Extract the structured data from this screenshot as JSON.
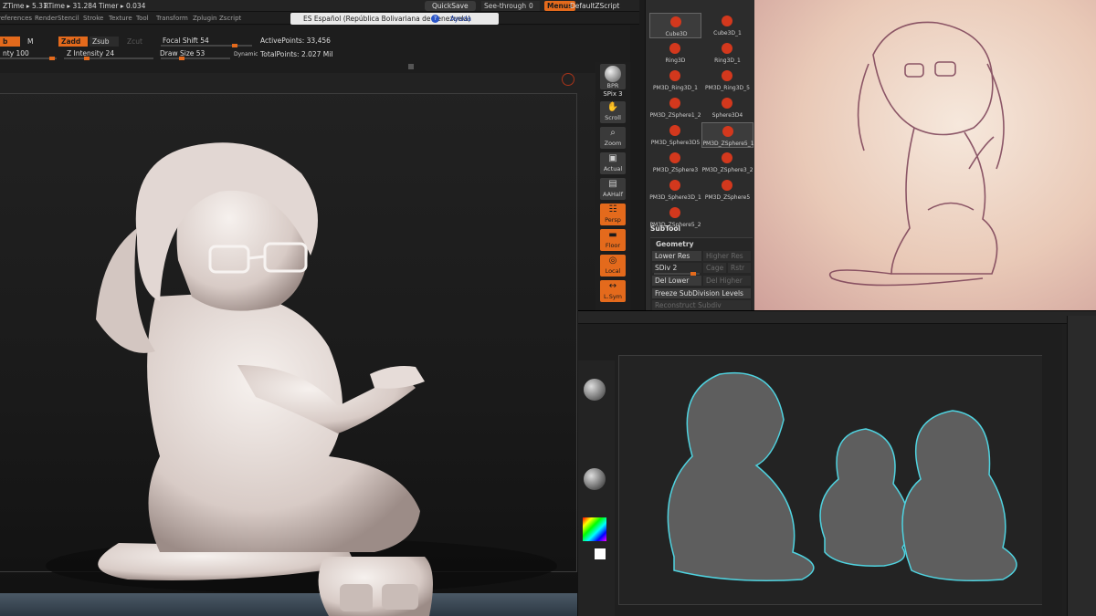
{
  "status": {
    "ztime": "ZTime ▸ 5.31",
    "rtime": "RTime ▸ 31.284",
    "timer": "Timer ▸ 0.034",
    "quicksave": "QuickSave",
    "seethrough": "See-through",
    "seethrough_value": "0",
    "menus": "Menus",
    "script": "DefaultZScript"
  },
  "menubar": {
    "items": [
      "references",
      "Render",
      "Stencil",
      "Stroke",
      "Texture",
      "Tool",
      "Transform",
      "Zplugin",
      "Zscript"
    ]
  },
  "language": {
    "label": "ES Español (República Bolivariana de Venezuela)",
    "help": "Ayuda"
  },
  "brush": {
    "rgb_label": "b",
    "m_label": "M",
    "zadd": "Zadd",
    "zsub": "Zsub",
    "zcut": "Zcut",
    "focal_shift": "Focal Shift 54",
    "draw_size": "Draw Size 53",
    "dynamic": "Dynamic",
    "intensity_left": "nty 100",
    "z_intensity": "Z Intensity 24",
    "active_points": "ActivePoints: 33,456",
    "total_points": "TotalPoints: 2.027 Mil"
  },
  "shelf": {
    "bpr": "BPR",
    "spix": "SPix 3",
    "buttons": [
      {
        "label": "Scroll",
        "icon": "hand-icon",
        "glyph": "✋",
        "active": false
      },
      {
        "label": "Zoom",
        "icon": "zoom-icon",
        "glyph": "⌕",
        "active": false
      },
      {
        "label": "Actual",
        "icon": "actual-icon",
        "glyph": "▣",
        "active": false
      },
      {
        "label": "AAHalf",
        "icon": "aahalf-icon",
        "glyph": "▤",
        "active": false
      },
      {
        "label": "Persp",
        "icon": "perspective-icon",
        "glyph": "☷",
        "active": true
      },
      {
        "label": "Floor",
        "icon": "floor-icon",
        "glyph": "▬",
        "active": true
      },
      {
        "label": "Local",
        "icon": "local-icon",
        "glyph": "◎",
        "active": true
      },
      {
        "label": "L.Sym",
        "icon": "symmetry-icon",
        "glyph": "↔",
        "active": true
      }
    ]
  },
  "tools": {
    "items": [
      {
        "label": "Cube3D",
        "selected": true
      },
      {
        "label": "Cube3D_1",
        "selected": false
      },
      {
        "label": "Ring3D",
        "selected": false
      },
      {
        "label": "Ring3D_1",
        "selected": false
      },
      {
        "label": "PM3D_Ring3D_1",
        "selected": false
      },
      {
        "label": "PM3D_Ring3D_5",
        "selected": false
      },
      {
        "label": "PM3D_ZSphere1_2",
        "selected": false
      },
      {
        "label": "Sphere3D4",
        "selected": false
      },
      {
        "label": "PM3D_Sphere3D5",
        "selected": false
      },
      {
        "label": "PM3D_ZSphere5_1",
        "selected": true
      },
      {
        "label": "PM3D_ZSphere3",
        "selected": false
      },
      {
        "label": "PM3D_ZSphere3_2",
        "selected": false
      },
      {
        "label": "PM3D_Sphere3D_1",
        "selected": false
      },
      {
        "label": "PM3D_ZSphere5",
        "selected": false
      },
      {
        "label": "PM3D_ZSphere5_2",
        "selected": false
      }
    ],
    "subtool": "SubTool",
    "geometry": "Geometry",
    "lower_res": "Lower Res",
    "higher_res": "Higher Res",
    "sdiv": "SDiv 2",
    "cage": "Cage",
    "rstr": "Rstr",
    "del_lower": "Del Lower",
    "del_higher": "Del Higher",
    "freeze": "Freeze SubDivision Levels",
    "reconstruct": "Reconstruct Subdiv"
  },
  "colors": {
    "accent": "#e46a1c",
    "panel": "#2c2c2c",
    "background": "#1b1b1b",
    "model": "#e9e2df",
    "sketch_paper": "#f3e1d4",
    "sketch_line": "#7a3f55",
    "rim_light": "#4fd3e0"
  }
}
